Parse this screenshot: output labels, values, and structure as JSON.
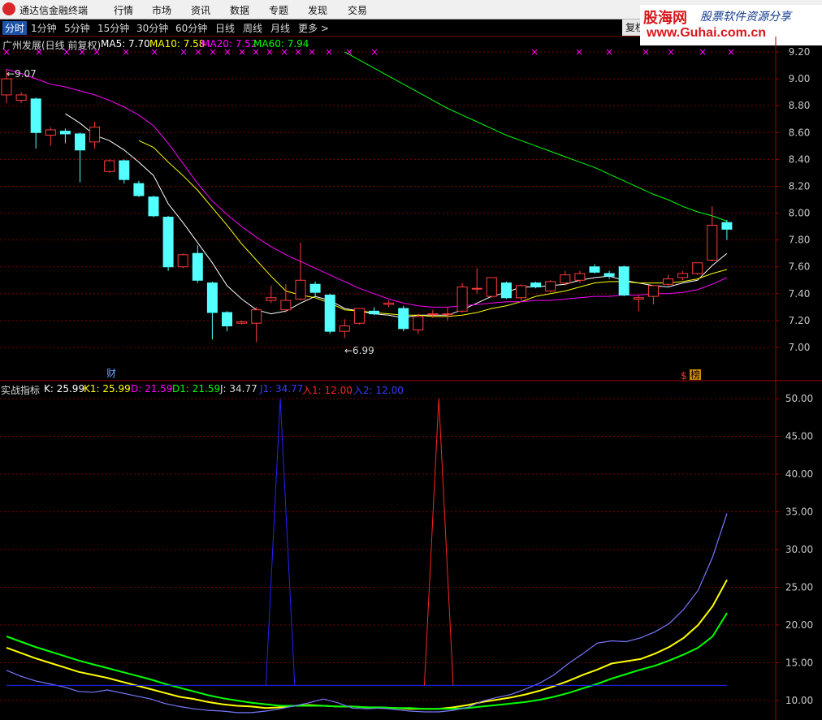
{
  "app": {
    "title": "通达信金融终端",
    "menus": [
      "行情",
      "市场",
      "资讯",
      "数据",
      "专题",
      "发现",
      "交易"
    ]
  },
  "watermark": {
    "brand": "股海网",
    "slogan": "股票软件资源分享",
    "url": "www.Guhai.com.cn"
  },
  "toolbar": {
    "items": [
      "分时",
      "1分钟",
      "5分钟",
      "15分钟",
      "30分钟",
      "60分钟",
      "日线",
      "周线",
      "月线",
      "更多 >"
    ],
    "active": "分时",
    "fuquan": "复权"
  },
  "price_panel": {
    "header": {
      "title": "广州发展(日线 前复权)",
      "ma5": "MA5: 7.70",
      "ma10": "MA10: 7.58",
      "ma20": "MA20: 7.52",
      "ma60": "MA60: 7.94"
    },
    "annotations": {
      "high": "9.07",
      "low": "6.99",
      "cai": "财",
      "dollar": "$",
      "bang": "榜"
    },
    "colors": {
      "up": "#ff3c3c",
      "down": "#54ffff",
      "ma5": "#ffffff",
      "ma10": "#ffff00",
      "ma20": "#ff00ff",
      "ma60": "#00ff00"
    }
  },
  "indicator_panel": {
    "header": {
      "name": "实战指标",
      "k": "K: 25.99",
      "k1": "K1: 25.99",
      "d": "D: 21.59",
      "d1": "D1: 21.59",
      "j": "J: 34.77",
      "j1": "J1: 34.77",
      "buy1": "入1: 12.00",
      "buy2": "入2: 12.00"
    }
  },
  "chart_data": [
    {
      "type": "candlestick",
      "title": "广州发展(日线 前复权)",
      "y_ticks": [
        "9.20",
        "9.00",
        "8.80",
        "8.60",
        "8.40",
        "8.20",
        "8.00",
        "7.80",
        "7.60",
        "7.40",
        "7.20",
        "7.00"
      ],
      "ylim": [
        6.8,
        9.22
      ],
      "candles": [
        {
          "o": 8.88,
          "h": 9.07,
          "l": 8.82,
          "c": 9.0
        },
        {
          "o": 8.84,
          "h": 8.9,
          "l": 8.82,
          "c": 8.88
        },
        {
          "o": 8.85,
          "h": 8.86,
          "l": 8.48,
          "c": 8.6
        },
        {
          "o": 8.58,
          "h": 8.64,
          "l": 8.5,
          "c": 8.62
        },
        {
          "o": 8.61,
          "h": 8.63,
          "l": 8.52,
          "c": 8.59
        },
        {
          "o": 8.59,
          "h": 8.6,
          "l": 8.23,
          "c": 8.47
        },
        {
          "o": 8.53,
          "h": 8.68,
          "l": 8.48,
          "c": 8.64
        },
        {
          "o": 8.31,
          "h": 8.4,
          "l": 8.3,
          "c": 8.39
        },
        {
          "o": 8.39,
          "h": 8.4,
          "l": 8.22,
          "c": 8.25
        },
        {
          "o": 8.22,
          "h": 8.24,
          "l": 8.12,
          "c": 8.13
        },
        {
          "o": 8.12,
          "h": 8.13,
          "l": 7.97,
          "c": 7.98
        },
        {
          "o": 7.97,
          "h": 7.98,
          "l": 7.57,
          "c": 7.6
        },
        {
          "o": 7.6,
          "h": 7.7,
          "l": 7.59,
          "c": 7.69
        },
        {
          "o": 7.7,
          "h": 7.76,
          "l": 7.48,
          "c": 7.5
        },
        {
          "o": 7.48,
          "h": 7.49,
          "l": 7.06,
          "c": 7.26
        },
        {
          "o": 7.26,
          "h": 7.27,
          "l": 7.12,
          "c": 7.16
        },
        {
          "o": 7.18,
          "h": 7.2,
          "l": 7.17,
          "c": 7.19
        },
        {
          "o": 7.18,
          "h": 7.3,
          "l": 7.04,
          "c": 7.28
        },
        {
          "o": 7.35,
          "h": 7.46,
          "l": 7.33,
          "c": 7.37
        },
        {
          "o": 7.28,
          "h": 7.47,
          "l": 7.26,
          "c": 7.35
        },
        {
          "o": 7.36,
          "h": 7.78,
          "l": 7.35,
          "c": 7.5
        },
        {
          "o": 7.47,
          "h": 7.49,
          "l": 7.38,
          "c": 7.41
        },
        {
          "o": 7.39,
          "h": 7.4,
          "l": 7.1,
          "c": 7.12
        },
        {
          "o": 7.12,
          "h": 7.21,
          "l": 7.07,
          "c": 7.16
        },
        {
          "o": 7.18,
          "h": 7.29,
          "l": 7.17,
          "c": 7.29
        },
        {
          "o": 7.27,
          "h": 7.3,
          "l": 7.24,
          "c": 7.25
        },
        {
          "o": 7.32,
          "h": 7.35,
          "l": 7.3,
          "c": 7.33
        },
        {
          "o": 7.29,
          "h": 7.31,
          "l": 7.12,
          "c": 7.14
        },
        {
          "o": 7.13,
          "h": 7.25,
          "l": 7.1,
          "c": 7.23
        },
        {
          "o": 7.25,
          "h": 7.28,
          "l": 7.22,
          "c": 7.25
        },
        {
          "o": 7.25,
          "h": 7.3,
          "l": 7.2,
          "c": 7.25
        },
        {
          "o": 7.27,
          "h": 7.48,
          "l": 7.26,
          "c": 7.45
        },
        {
          "o": 7.44,
          "h": 7.59,
          "l": 7.4,
          "c": 7.44
        },
        {
          "o": 7.38,
          "h": 7.52,
          "l": 7.37,
          "c": 7.52
        },
        {
          "o": 7.48,
          "h": 7.49,
          "l": 7.36,
          "c": 7.37
        },
        {
          "o": 7.37,
          "h": 7.47,
          "l": 7.35,
          "c": 7.46
        },
        {
          "o": 7.48,
          "h": 7.49,
          "l": 7.44,
          "c": 7.45
        },
        {
          "o": 7.42,
          "h": 7.5,
          "l": 7.41,
          "c": 7.49
        },
        {
          "o": 7.48,
          "h": 7.57,
          "l": 7.46,
          "c": 7.54
        },
        {
          "o": 7.5,
          "h": 7.57,
          "l": 7.48,
          "c": 7.55
        },
        {
          "o": 7.6,
          "h": 7.62,
          "l": 7.55,
          "c": 7.56
        },
        {
          "o": 7.55,
          "h": 7.57,
          "l": 7.51,
          "c": 7.53
        },
        {
          "o": 7.6,
          "h": 7.61,
          "l": 7.38,
          "c": 7.39
        },
        {
          "o": 7.36,
          "h": 7.39,
          "l": 7.27,
          "c": 7.37
        },
        {
          "o": 7.38,
          "h": 7.45,
          "l": 7.32,
          "c": 7.46
        },
        {
          "o": 7.47,
          "h": 7.54,
          "l": 7.46,
          "c": 7.51
        },
        {
          "o": 7.52,
          "h": 7.57,
          "l": 7.5,
          "c": 7.55
        },
        {
          "o": 7.55,
          "h": 7.63,
          "l": 7.54,
          "c": 7.63
        },
        {
          "o": 7.65,
          "h": 8.05,
          "l": 7.64,
          "c": 7.91
        },
        {
          "o": 7.93,
          "h": 7.95,
          "l": 7.8,
          "c": 7.88
        }
      ],
      "series": [
        {
          "name": "MA5",
          "values": [
            null,
            null,
            null,
            null,
            8.74,
            8.67,
            8.58,
            8.54,
            8.47,
            8.38,
            8.28,
            8.07,
            7.93,
            7.78,
            7.63,
            7.46,
            7.36,
            7.28,
            7.25,
            7.27,
            7.33,
            7.38,
            7.35,
            7.29,
            7.27,
            7.25,
            7.24,
            7.22,
            7.24,
            7.24,
            7.24,
            7.28,
            7.33,
            7.38,
            7.41,
            7.45,
            7.45,
            7.46,
            7.47,
            7.5,
            7.52,
            7.53,
            7.5,
            7.48,
            7.46,
            7.45,
            7.48,
            7.5,
            7.61,
            7.7
          ]
        },
        {
          "name": "MA10",
          "values": [
            null,
            null,
            null,
            null,
            null,
            null,
            null,
            null,
            null,
            8.54,
            8.49,
            8.38,
            8.28,
            8.17,
            8.04,
            7.91,
            7.77,
            7.65,
            7.53,
            7.42,
            7.39,
            7.37,
            7.33,
            7.28,
            7.27,
            7.26,
            7.25,
            7.24,
            7.24,
            7.23,
            7.23,
            7.24,
            7.26,
            7.29,
            7.31,
            7.34,
            7.38,
            7.4,
            7.42,
            7.45,
            7.48,
            7.49,
            7.49,
            7.48,
            7.48,
            7.48,
            7.49,
            7.51,
            7.55,
            7.58
          ]
        },
        {
          "name": "MA20",
          "values": [
            9.07,
            9.04,
            9.0,
            8.96,
            8.94,
            8.91,
            8.88,
            8.84,
            8.79,
            8.73,
            8.65,
            8.52,
            8.37,
            8.22,
            8.09,
            7.99,
            7.9,
            7.82,
            7.75,
            7.69,
            7.64,
            7.59,
            7.54,
            7.49,
            7.44,
            7.4,
            7.36,
            7.33,
            7.31,
            7.3,
            7.3,
            7.31,
            7.32,
            7.33,
            7.34,
            7.34,
            7.35,
            7.35,
            7.36,
            7.37,
            7.38,
            7.38,
            7.39,
            7.39,
            7.4,
            7.4,
            7.41,
            7.43,
            7.47,
            7.52
          ]
        },
        {
          "name": "MA60",
          "values": [
            null,
            null,
            null,
            null,
            null,
            null,
            null,
            null,
            null,
            null,
            null,
            null,
            null,
            null,
            null,
            null,
            null,
            null,
            null,
            null,
            null,
            null,
            null,
            9.2,
            9.14,
            9.08,
            9.02,
            8.96,
            8.9,
            8.84,
            8.78,
            8.73,
            8.68,
            8.63,
            8.58,
            8.54,
            8.5,
            8.46,
            8.42,
            8.38,
            8.34,
            8.29,
            8.24,
            8.19,
            8.14,
            8.1,
            8.05,
            8.01,
            7.98,
            7.94
          ]
        }
      ]
    },
    {
      "type": "line",
      "title": "实战指标",
      "y_ticks": [
        "50.00",
        "45.00",
        "40.00",
        "35.00",
        "30.00",
        "25.00",
        "20.00",
        "15.00",
        "10.00"
      ],
      "ylim": [
        7.6,
        51.2
      ],
      "series": [
        {
          "name": "K",
          "color": "#ffff00",
          "values": [
            17.0,
            16.3,
            15.6,
            15.0,
            14.4,
            13.8,
            13.4,
            13.0,
            12.5,
            12.0,
            11.5,
            11.0,
            10.5,
            10.2,
            9.8,
            9.5,
            9.3,
            9.2,
            9.0,
            9.1,
            9.3,
            9.4,
            9.3,
            9.2,
            9.2,
            9.1,
            9.0,
            9.0,
            8.9,
            8.9,
            8.9,
            9.1,
            9.4,
            9.8,
            10.1,
            10.4,
            10.8,
            11.3,
            11.9,
            12.6,
            13.4,
            14.1,
            14.9,
            15.2,
            15.5,
            16.2,
            17.1,
            18.3,
            20.0,
            22.5,
            25.99
          ]
        },
        {
          "name": "D",
          "color": "#00ff00",
          "values": [
            18.5,
            17.8,
            17.1,
            16.5,
            15.9,
            15.3,
            14.8,
            14.3,
            13.8,
            13.3,
            12.8,
            12.2,
            11.7,
            11.2,
            10.7,
            10.3,
            10.0,
            9.7,
            9.5,
            9.3,
            9.3,
            9.3,
            9.3,
            9.2,
            9.2,
            9.1,
            9.1,
            9.0,
            9.0,
            8.9,
            8.9,
            8.9,
            9.0,
            9.2,
            9.4,
            9.6,
            9.8,
            10.1,
            10.5,
            11.0,
            11.6,
            12.2,
            12.9,
            13.5,
            14.1,
            14.6,
            15.3,
            16.1,
            17.0,
            18.5,
            21.59
          ]
        },
        {
          "name": "J",
          "color": "#7878ff",
          "values": [
            14.0,
            13.2,
            12.6,
            12.2,
            11.8,
            11.2,
            11.1,
            11.4,
            11.0,
            10.6,
            10.2,
            9.6,
            9.2,
            8.9,
            8.7,
            8.6,
            8.4,
            8.4,
            8.6,
            8.9,
            9.3,
            9.7,
            10.2,
            9.7,
            9.0,
            8.9,
            9.0,
            8.8,
            8.6,
            8.5,
            8.5,
            8.7,
            9.1,
            9.9,
            10.4,
            10.8,
            11.5,
            12.3,
            13.4,
            14.9,
            16.2,
            17.6,
            17.9,
            17.8,
            18.3,
            19.1,
            20.2,
            22.1,
            24.6,
            29.0,
            34.77
          ]
        },
        {
          "name": "入1",
          "color": "#ff2222",
          "segment": {
            "x": [
              29,
              30,
              31
            ],
            "values": [
              12.0,
              50.0,
              12.0
            ]
          }
        },
        {
          "name": "入2",
          "color": "#2222ff",
          "baseline": 12.0,
          "spike": {
            "x": [
              18,
              19,
              20
            ],
            "values": [
              12.0,
              50.0,
              12.0
            ]
          }
        }
      ]
    }
  ]
}
